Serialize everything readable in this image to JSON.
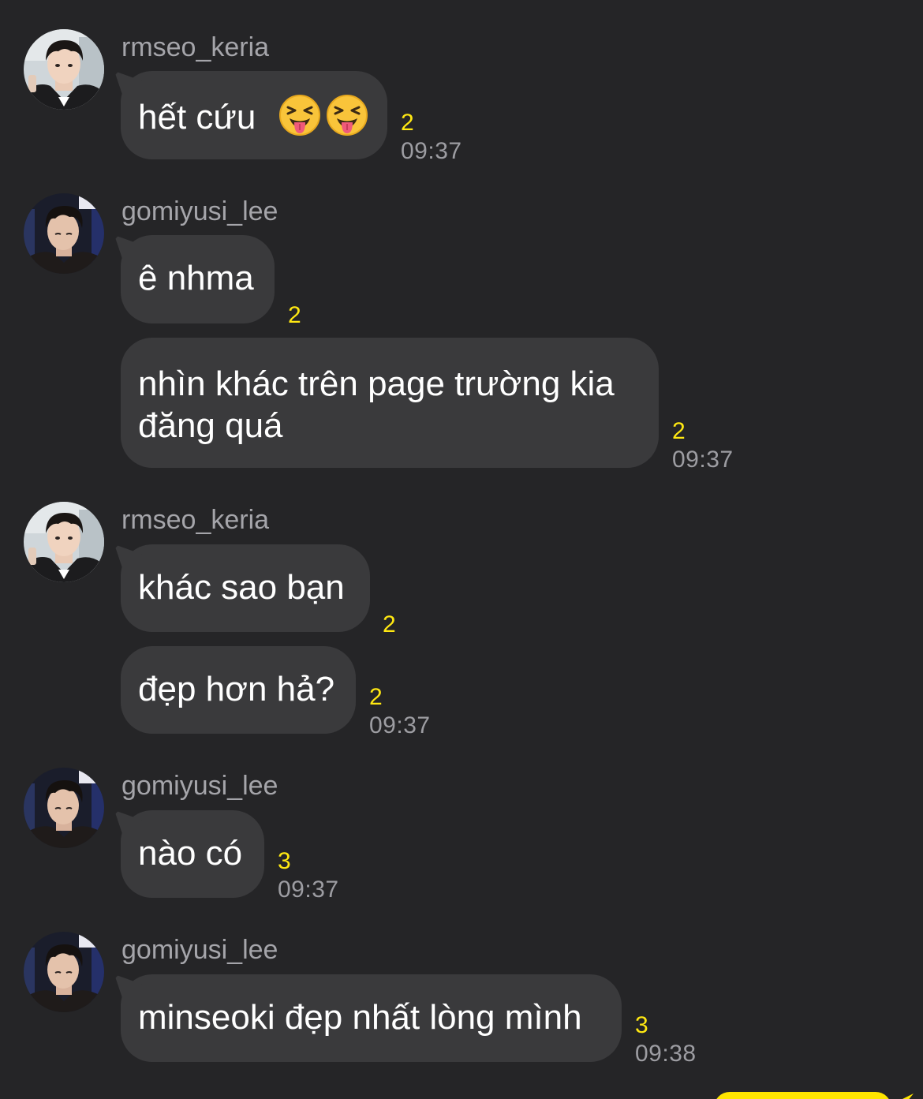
{
  "colors": {
    "background": "#252527",
    "bubble": "#3a3a3c",
    "unread_count": "#ffe812",
    "my_bubble": "#fee500"
  },
  "messages": [
    {
      "sender": "rmseo_keria",
      "avatar": "avatar-rmseo-keria",
      "text": "hết cứu",
      "emoji": [
        "squinting-face-with-tongue-icon",
        "squinting-face-with-tongue-icon"
      ],
      "unread": "2",
      "time": "09:37"
    },
    {
      "sender": "gomiyusi_lee",
      "avatar": "avatar-gomiyusi-lee",
      "text": "ê nhma",
      "unread": "2"
    },
    {
      "text_line1": "nhìn khác trên page trường kia",
      "text_line2": "đăng quá",
      "unread": "2",
      "time": "09:37"
    },
    {
      "sender": "rmseo_keria",
      "avatar": "avatar-rmseo-keria",
      "text": "khác sao bạn",
      "unread": "2"
    },
    {
      "text": "đẹp hơn hả?",
      "unread": "2",
      "time": "09:37"
    },
    {
      "sender": "gomiyusi_lee",
      "avatar": "avatar-gomiyusi-lee",
      "text": "nào có",
      "unread": "3",
      "time": "09:37"
    },
    {
      "sender": "gomiyusi_lee",
      "avatar": "avatar-gomiyusi-lee",
      "text": "minseoki đẹp nhất lòng mình",
      "unread": "3",
      "time": "09:38"
    }
  ]
}
